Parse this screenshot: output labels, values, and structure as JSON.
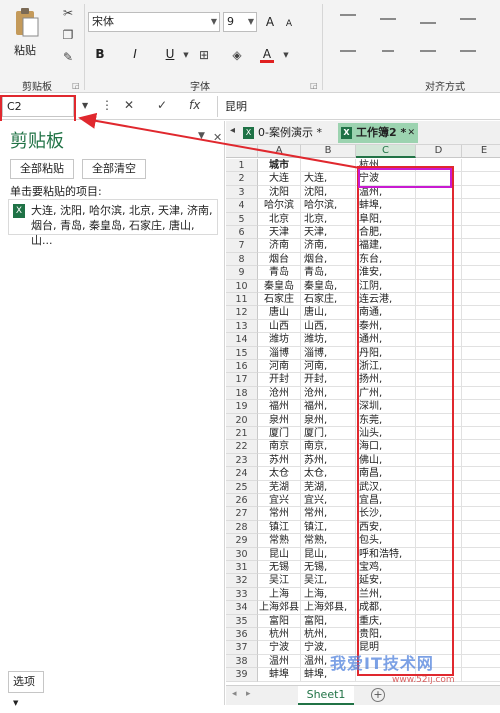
{
  "ribbon": {
    "paste_label": "粘贴",
    "clipboard_group": "剪贴板",
    "font_group": "字体",
    "align_group": "对齐方式",
    "font_name": "宋体",
    "font_size": "9",
    "bold": "B",
    "italic": "I",
    "underline": "U",
    "font_color_letter": "A",
    "grow_font": "A",
    "shrink_font": "A"
  },
  "formula_bar": {
    "name_box": "C2",
    "cancel": "✕",
    "enter": "✓",
    "fx": "fx",
    "value": "昆明"
  },
  "clipboard_pane": {
    "title": "剪贴板",
    "paste_all": "全部粘贴",
    "clear_all": "全部清空",
    "hint": "单击要粘贴的项目:",
    "item_text": "大连, 沈阳, 哈尔滨, 北京, 天津, 济南, 烟台, 青岛, 秦皇岛, 石家庄, 唐山, 山...",
    "options": "选项"
  },
  "workbook_tabs": [
    {
      "label": "0-案例演示 *",
      "active": false
    },
    {
      "label": "工作簿2 *",
      "active": true
    }
  ],
  "columns": [
    "A",
    "B",
    "C",
    "D",
    "E"
  ],
  "selected_column": "C",
  "rows": [
    {
      "n": "1",
      "a": "城市",
      "b": "",
      "c": "杭州,"
    },
    {
      "n": "2",
      "a": "大连",
      "b": "大连,",
      "c": "宁波"
    },
    {
      "n": "3",
      "a": "沈阳",
      "b": "沈阳,",
      "c": "温州,"
    },
    {
      "n": "4",
      "a": "哈尔滨",
      "b": "哈尔滨,",
      "c": "蚌埠,"
    },
    {
      "n": "5",
      "a": "北京",
      "b": "北京,",
      "c": "阜阳,"
    },
    {
      "n": "6",
      "a": "天津",
      "b": "天津,",
      "c": "合肥,"
    },
    {
      "n": "7",
      "a": "济南",
      "b": "济南,",
      "c": "福建,"
    },
    {
      "n": "8",
      "a": "烟台",
      "b": "烟台,",
      "c": "东台,"
    },
    {
      "n": "9",
      "a": "青岛",
      "b": "青岛,",
      "c": "淮安,"
    },
    {
      "n": "10",
      "a": "秦皇岛",
      "b": "秦皇岛,",
      "c": "江阴,"
    },
    {
      "n": "11",
      "a": "石家庄",
      "b": "石家庄,",
      "c": "连云港,"
    },
    {
      "n": "12",
      "a": "唐山",
      "b": "唐山,",
      "c": "南通,"
    },
    {
      "n": "13",
      "a": "山西",
      "b": "山西,",
      "c": "泰州,"
    },
    {
      "n": "14",
      "a": "潍坊",
      "b": "潍坊,",
      "c": "通州,"
    },
    {
      "n": "15",
      "a": "淄博",
      "b": "淄博,",
      "c": "丹阳,"
    },
    {
      "n": "16",
      "a": "河南",
      "b": "河南,",
      "c": "浙江,"
    },
    {
      "n": "17",
      "a": "开封",
      "b": "开封,",
      "c": "扬州,"
    },
    {
      "n": "18",
      "a": "沧州",
      "b": "沧州,",
      "c": "广州,"
    },
    {
      "n": "19",
      "a": "福州",
      "b": "福州,",
      "c": "深圳,"
    },
    {
      "n": "20",
      "a": "泉州",
      "b": "泉州,",
      "c": "东莞,"
    },
    {
      "n": "21",
      "a": "厦门",
      "b": "厦门,",
      "c": "汕头,"
    },
    {
      "n": "22",
      "a": "南京",
      "b": "南京,",
      "c": "海口,"
    },
    {
      "n": "23",
      "a": "苏州",
      "b": "苏州,",
      "c": "佛山,"
    },
    {
      "n": "24",
      "a": "太仓",
      "b": "太仓,",
      "c": "南昌,"
    },
    {
      "n": "25",
      "a": "芜湖",
      "b": "芜湖,",
      "c": "武汉,"
    },
    {
      "n": "26",
      "a": "宜兴",
      "b": "宜兴,",
      "c": "宜昌,"
    },
    {
      "n": "27",
      "a": "常州",
      "b": "常州,",
      "c": "长沙,"
    },
    {
      "n": "28",
      "a": "镇江",
      "b": "镇江,",
      "c": "西安,"
    },
    {
      "n": "29",
      "a": "常熟",
      "b": "常熟,",
      "c": "包头,"
    },
    {
      "n": "30",
      "a": "昆山",
      "b": "昆山,",
      "c": "呼和浩特,"
    },
    {
      "n": "31",
      "a": "无锡",
      "b": "无锡,",
      "c": "宝鸡,"
    },
    {
      "n": "32",
      "a": "吴江",
      "b": "吴江,",
      "c": "延安,"
    },
    {
      "n": "33",
      "a": "上海",
      "b": "上海,",
      "c": "兰州,"
    },
    {
      "n": "34",
      "a": "上海郊县",
      "b": "上海郊县,",
      "c": "成都,"
    },
    {
      "n": "35",
      "a": "富阳",
      "b": "富阳,",
      "c": "重庆,"
    },
    {
      "n": "36",
      "a": "杭州",
      "b": "杭州,",
      "c": "贵阳,"
    },
    {
      "n": "37",
      "a": "宁波",
      "b": "宁波,",
      "c": "昆明"
    },
    {
      "n": "38",
      "a": "温州",
      "b": "温州,",
      "c": ""
    },
    {
      "n": "39",
      "a": "蚌埠",
      "b": "蚌埠,",
      "c": ""
    }
  ],
  "sheet_tab": "Sheet1",
  "watermark": "我爱IT技术网",
  "watermark_url": "www.52ij.com",
  "colors": {
    "excel_green": "#217346",
    "annotation_red": "#e0282e",
    "annotation_magenta": "#c81ad1"
  }
}
